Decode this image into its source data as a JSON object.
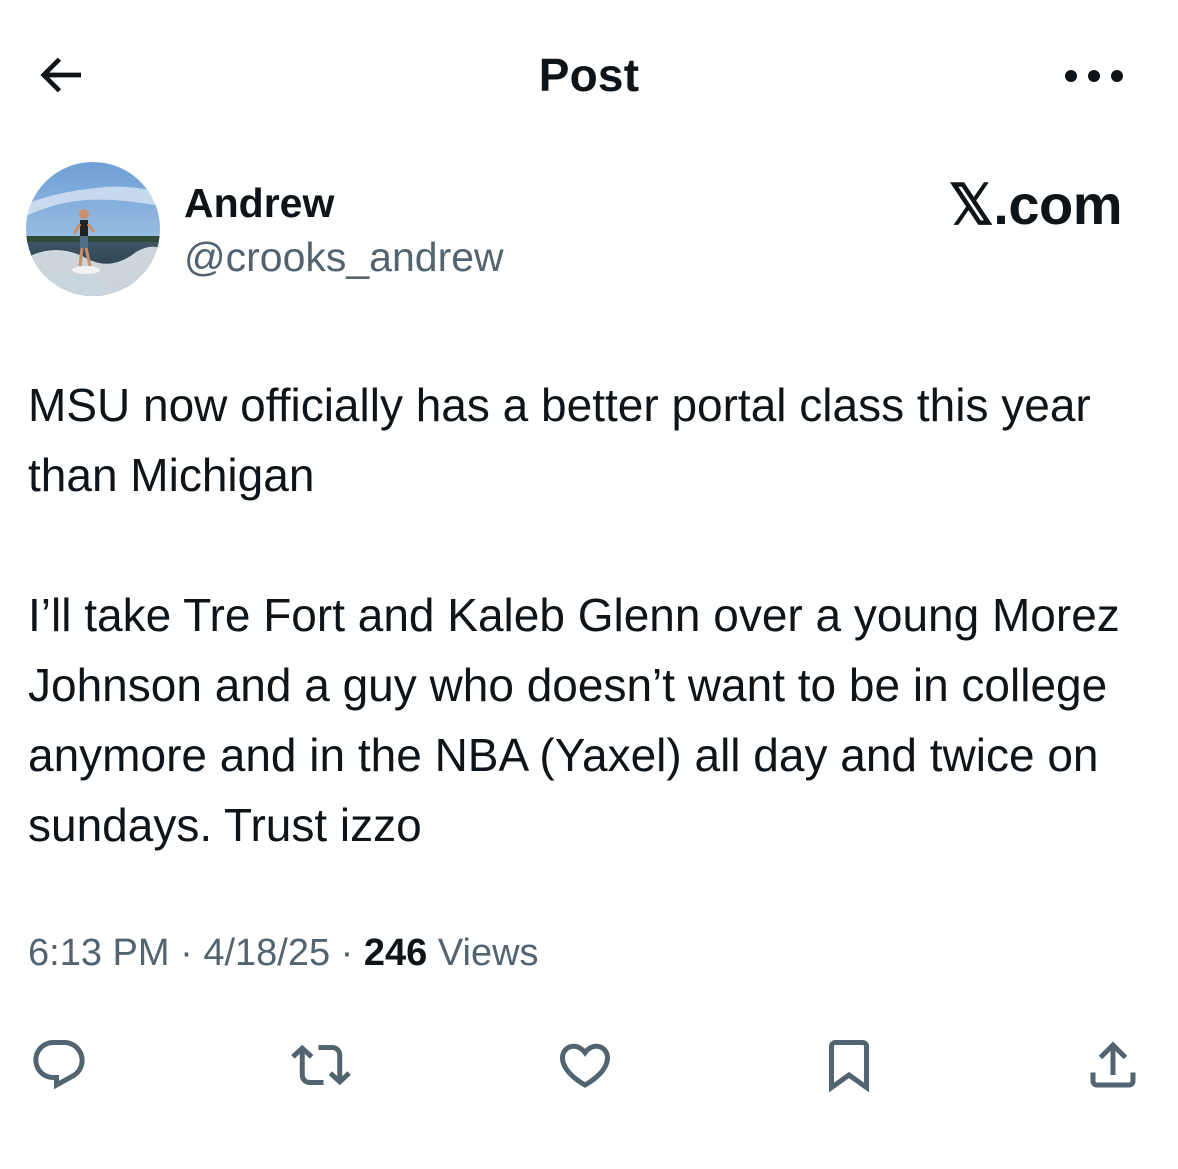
{
  "header": {
    "title": "Post",
    "back_icon": "arrow-left-icon",
    "more_icon": "more-horizontal-icon"
  },
  "author": {
    "display_name": "Andrew",
    "handle": "@crooks_andrew",
    "avatar_icon": "avatar-wakesurf-photo"
  },
  "source_badge": "𝕏.com",
  "post": {
    "paragraphs": [
      "MSU now officially has a better portal class this year than Michigan",
      "I’ll take Tre Fort and Kaleb Glenn over a young Morez Johnson and a guy who doesn’t want to be in college anymore and in the NBA (Yaxel) all day and twice on sundays. Trust izzo"
    ]
  },
  "meta": {
    "time": "6:13 PM",
    "separator": " · ",
    "date": "4/18/25",
    "views_count": "246",
    "views_label": " Views"
  },
  "actions": [
    {
      "name": "reply",
      "icon": "reply-icon"
    },
    {
      "name": "repost",
      "icon": "repost-icon"
    },
    {
      "name": "like",
      "icon": "heart-icon"
    },
    {
      "name": "bookmark",
      "icon": "bookmark-icon"
    },
    {
      "name": "share",
      "icon": "share-icon"
    }
  ],
  "colors": {
    "text_primary": "#0f1419",
    "text_secondary": "#536471",
    "background": "#ffffff"
  }
}
